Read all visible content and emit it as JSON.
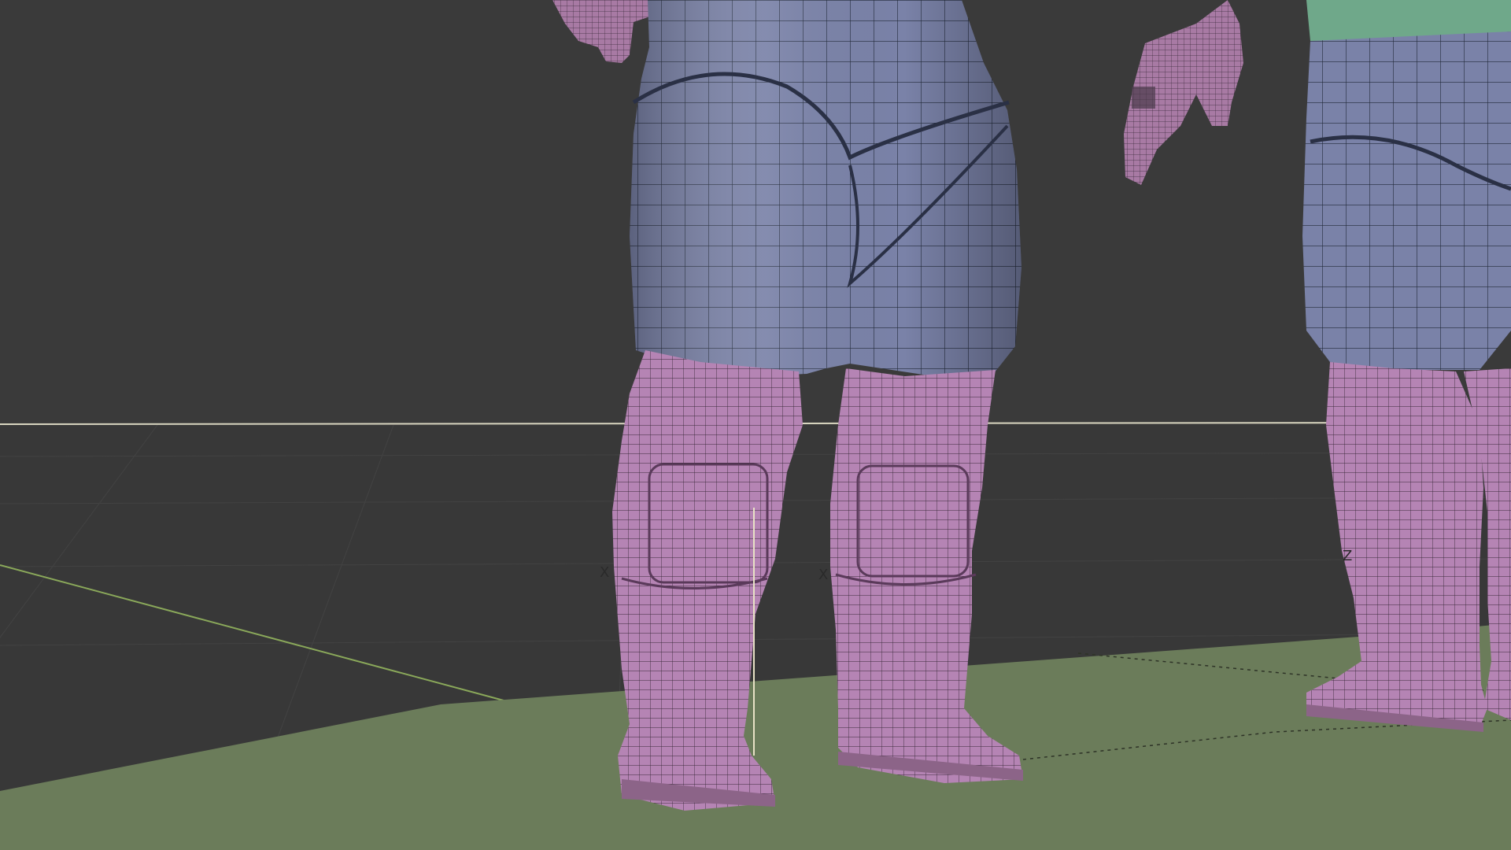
{
  "viewport": {
    "background_color": "#3a3a3a",
    "ground_color": "#6b7c5a",
    "grid_line_color": "#474747",
    "horizon_line_color": "#d9d6c0",
    "x_axis_color": "#8aa85a"
  },
  "materials": {
    "suit_color": "#7a82a8",
    "boot_color": "#b584b4",
    "collar_color": "#6fa88a",
    "wire_color": "#222a3a"
  },
  "empties": {
    "labels": [
      "X",
      "X",
      "Z"
    ]
  }
}
